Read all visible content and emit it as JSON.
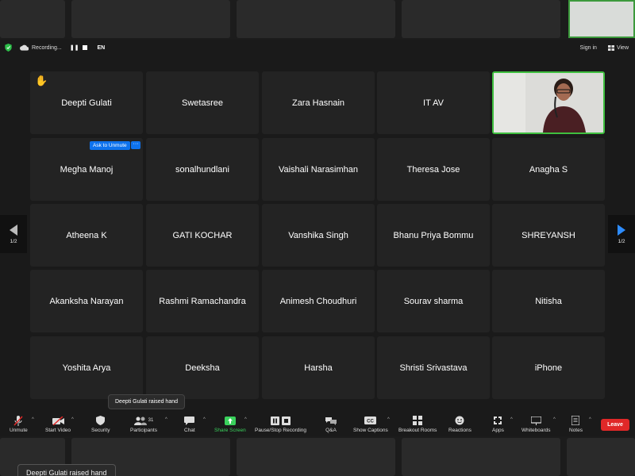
{
  "topbar": {
    "recording_label": "Recording...",
    "language": "EN",
    "sign_in": "Sign in",
    "view": "View"
  },
  "participants": [
    {
      "name": "Deepti Gulati",
      "raised_hand": true
    },
    {
      "name": "Swetasree"
    },
    {
      "name": "Zara Hasnain"
    },
    {
      "name": "IT AV"
    },
    {
      "name": "",
      "video": true
    },
    {
      "name": "Megha Manoj",
      "ask_to_unmute": "Ask to Unmute",
      "more": "···"
    },
    {
      "name": "sonalhundlani"
    },
    {
      "name": "Vaishali Narasimhan"
    },
    {
      "name": "Theresa Jose"
    },
    {
      "name": "Anagha S"
    },
    {
      "name": "Atheena K"
    },
    {
      "name": "GATI KOCHAR"
    },
    {
      "name": "Vanshika Singh"
    },
    {
      "name": "Bhanu Priya Bommu"
    },
    {
      "name": "SHREYANSH"
    },
    {
      "name": "Akanksha Narayan"
    },
    {
      "name": "Rashmi Ramachandra"
    },
    {
      "name": "Animesh Choudhuri"
    },
    {
      "name": "Sourav sharma"
    },
    {
      "name": "Nitisha"
    },
    {
      "name": "Yoshita Arya"
    },
    {
      "name": "Deeksha"
    },
    {
      "name": "Harsha"
    },
    {
      "name": "Shristi Srivastava"
    },
    {
      "name": "iPhone"
    }
  ],
  "pager": {
    "left": "1/2",
    "right": "1/2"
  },
  "tooltip": "Deepti Gulati raised hand",
  "toast_bottom": "Deepti Gulati raised hand",
  "toolbar": {
    "unmute": "Unmute",
    "start_video": "Start Video",
    "security": "Security",
    "participants": "Participants",
    "participants_count": "31",
    "chat": "Chat",
    "share_screen": "Share Screen",
    "pause_stop_recording": "Pause/Stop Recording",
    "qa": "Q&A",
    "show_captions": "Show Captions",
    "breakout_rooms": "Breakout Rooms",
    "reactions": "Reactions",
    "apps": "Apps",
    "whiteboards": "Whiteboards",
    "notes": "Notes",
    "leave": "Leave"
  },
  "colors": {
    "accent_blue": "#0e72ed",
    "active_speaker_green": "#3fbf3f",
    "leave_red": "#e02828",
    "share_green": "#3ad15c"
  }
}
